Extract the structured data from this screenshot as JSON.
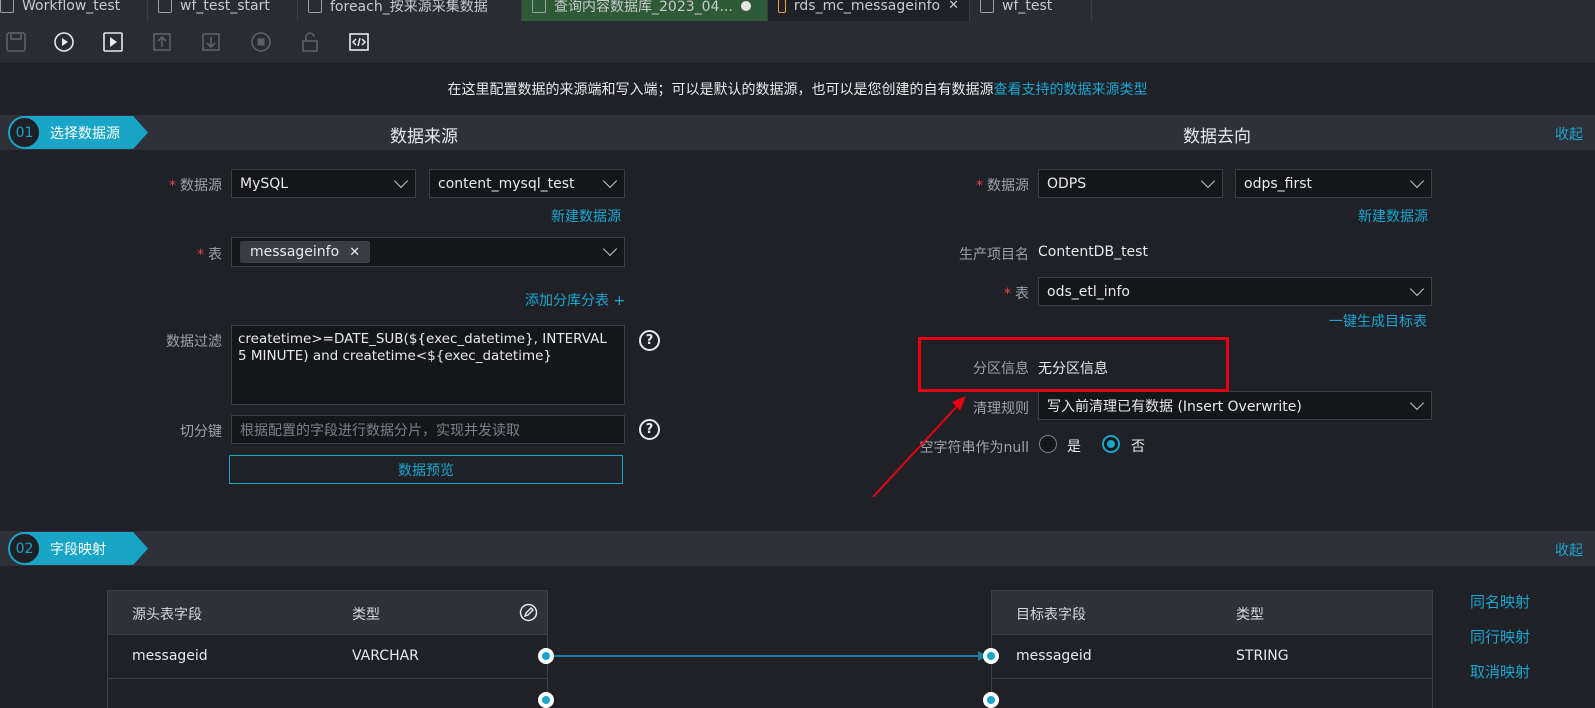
{
  "tabs": [
    {
      "label": "Workflow_test"
    },
    {
      "label": "wf_test_start"
    },
    {
      "label": "foreach_按来源采集数据"
    },
    {
      "label": "查询内容数据库_2023_04..."
    },
    {
      "label": "rds_mc_messageinfo"
    },
    {
      "label": "wf_test"
    }
  ],
  "notice": {
    "text": "在这里配置数据的来源端和写入端；可以是默认的数据源，也可以是您创建的自有数据源",
    "link": "查看支持的数据来源类型"
  },
  "section1": {
    "num": "01",
    "label": "选择数据源",
    "source_title": "数据来源",
    "target_title": "数据去向",
    "collapse": "收起"
  },
  "source": {
    "datasource_label": "数据源",
    "datasource_type": "MySQL",
    "datasource_name": "content_mysql_test",
    "new_datasource": "新建数据源",
    "table_label": "表",
    "table_tag": "messageinfo",
    "add_shard": "添加分库分表 +",
    "filter_label": "数据过滤",
    "filter_value": "createtime>=DATE_SUB(${exec_datetime}, INTERVAL 5 MINUTE)  and createtime<${exec_datetime}",
    "split_label": "切分键",
    "split_placeholder": "根据配置的字段进行数据分片，实现并发读取",
    "preview_button": "数据预览"
  },
  "target": {
    "datasource_label": "数据源",
    "datasource_type": "ODPS",
    "datasource_name": "odps_first",
    "new_datasource": "新建数据源",
    "project_label": "生产项目名",
    "project_value": "ContentDB_test",
    "table_label": "表",
    "table_value": "ods_etl_info",
    "gen_table": "一键生成目标表",
    "partition_label": "分区信息",
    "partition_value": "无分区信息",
    "clean_label": "清理规则",
    "clean_value": "写入前清理已有数据 (Insert Overwrite)",
    "null_label": "空字符串作为null",
    "null_yes": "是",
    "null_no": "否"
  },
  "section2": {
    "num": "02",
    "label": "字段映射",
    "collapse": "收起"
  },
  "mapping": {
    "src_headers": [
      "源头表字段",
      "类型"
    ],
    "tgt_headers": [
      "目标表字段",
      "类型"
    ],
    "src_rows": [
      {
        "field": "messageid",
        "type": "VARCHAR"
      }
    ],
    "tgt_rows": [
      {
        "field": "messageid",
        "type": "STRING"
      }
    ],
    "same_name": "同名映射",
    "same_row": "同行映射",
    "cancel": "取消映射"
  },
  "colors": {
    "accent": "#18a5c8",
    "highlight_box": "#e60012",
    "arrow": "#e60012"
  }
}
